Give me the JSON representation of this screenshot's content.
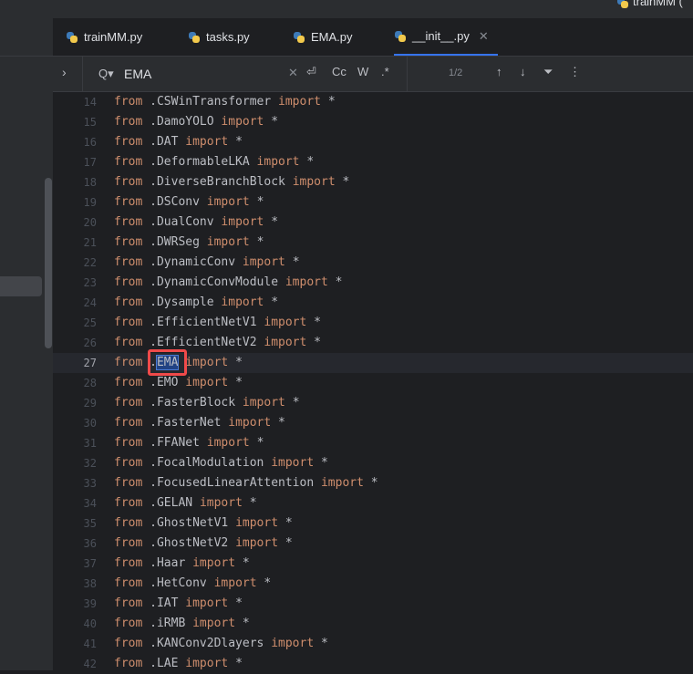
{
  "window": {
    "title": "trainMM ("
  },
  "tabs": [
    {
      "label": "trainMM.py",
      "active": false
    },
    {
      "label": "tasks.py",
      "active": false
    },
    {
      "label": "EMA.py",
      "active": false
    },
    {
      "label": "__init__.py",
      "active": true
    }
  ],
  "find": {
    "query": "EMA",
    "match_case_label": "Cc",
    "words_label": "W",
    "regex_label": ".*",
    "count": "1/2"
  },
  "editor": {
    "current_line": 27,
    "keyword_from": "from",
    "keyword_import": "import",
    "star": "*",
    "lines": [
      {
        "no": "14",
        "module": ".CSWinTransformer"
      },
      {
        "no": "15",
        "module": ".DamoYOLO"
      },
      {
        "no": "16",
        "module": ".DAT"
      },
      {
        "no": "17",
        "module": ".DeformableLKA"
      },
      {
        "no": "18",
        "module": ".DiverseBranchBlock"
      },
      {
        "no": "19",
        "module": ".DSConv"
      },
      {
        "no": "20",
        "module": ".DualConv"
      },
      {
        "no": "21",
        "module": ".DWRSeg"
      },
      {
        "no": "22",
        "module": ".DynamicConv"
      },
      {
        "no": "23",
        "module": ".DynamicConvModule"
      },
      {
        "no": "24",
        "module": ".Dysample"
      },
      {
        "no": "25",
        "module": ".EfficientNetV1"
      },
      {
        "no": "26",
        "module": ".EfficientNetV2"
      },
      {
        "no": "27",
        "module": ".EMA"
      },
      {
        "no": "28",
        "module": ".EMO"
      },
      {
        "no": "29",
        "module": ".FasterBlock"
      },
      {
        "no": "30",
        "module": ".FasterNet"
      },
      {
        "no": "31",
        "module": ".FFANet"
      },
      {
        "no": "32",
        "module": ".FocalModulation"
      },
      {
        "no": "33",
        "module": ".FocusedLinearAttention"
      },
      {
        "no": "34",
        "module": ".GELAN"
      },
      {
        "no": "35",
        "module": ".GhostNetV1"
      },
      {
        "no": "36",
        "module": ".GhostNetV2"
      },
      {
        "no": "37",
        "module": ".Haar"
      },
      {
        "no": "38",
        "module": ".HetConv"
      },
      {
        "no": "39",
        "module": ".IAT"
      },
      {
        "no": "40",
        "module": ".iRMB"
      },
      {
        "no": "41",
        "module": ".KANConv2Dlayers"
      },
      {
        "no": "42",
        "module": ".LAE"
      }
    ]
  },
  "colors": {
    "keyword": "#cf8e6d",
    "text": "#bcbec4",
    "accent": "#3574f0",
    "annotation": "#f04a4a"
  }
}
